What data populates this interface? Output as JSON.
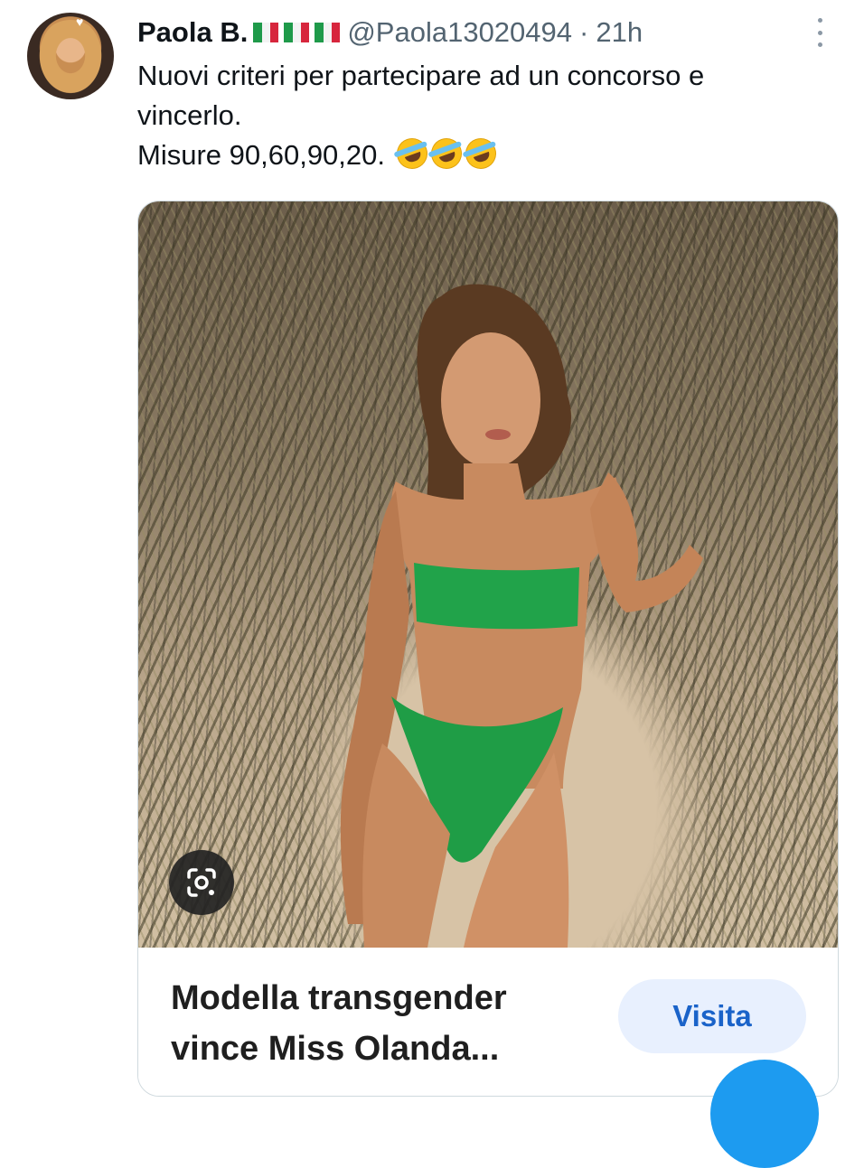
{
  "author": {
    "name": "Paola B.",
    "flags": [
      "italy-flag",
      "italy-flag",
      "italy-flag"
    ],
    "handle": "@Paola13020494",
    "separator": "·",
    "time": "21h"
  },
  "tweet": {
    "lines": [
      "Nuovi criteri per partecipare ad un concorso e",
      "vincerlo.",
      "Misure 90,60,90,20."
    ],
    "emojis": [
      "rolling-on-floor-laughing-emoji",
      "rolling-on-floor-laughing-emoji",
      "rolling-on-floor-laughing-emoji"
    ]
  },
  "card": {
    "title_lines": [
      "Modella transgender",
      "vince Miss Olanda..."
    ],
    "visit_label": "Visita",
    "lens_icon": "google-lens-icon"
  },
  "colors": {
    "accent": "#1d9bf0",
    "visit_bg": "#e8f0fe",
    "visit_text": "#1a63c9",
    "bikini": "#21a34a"
  }
}
